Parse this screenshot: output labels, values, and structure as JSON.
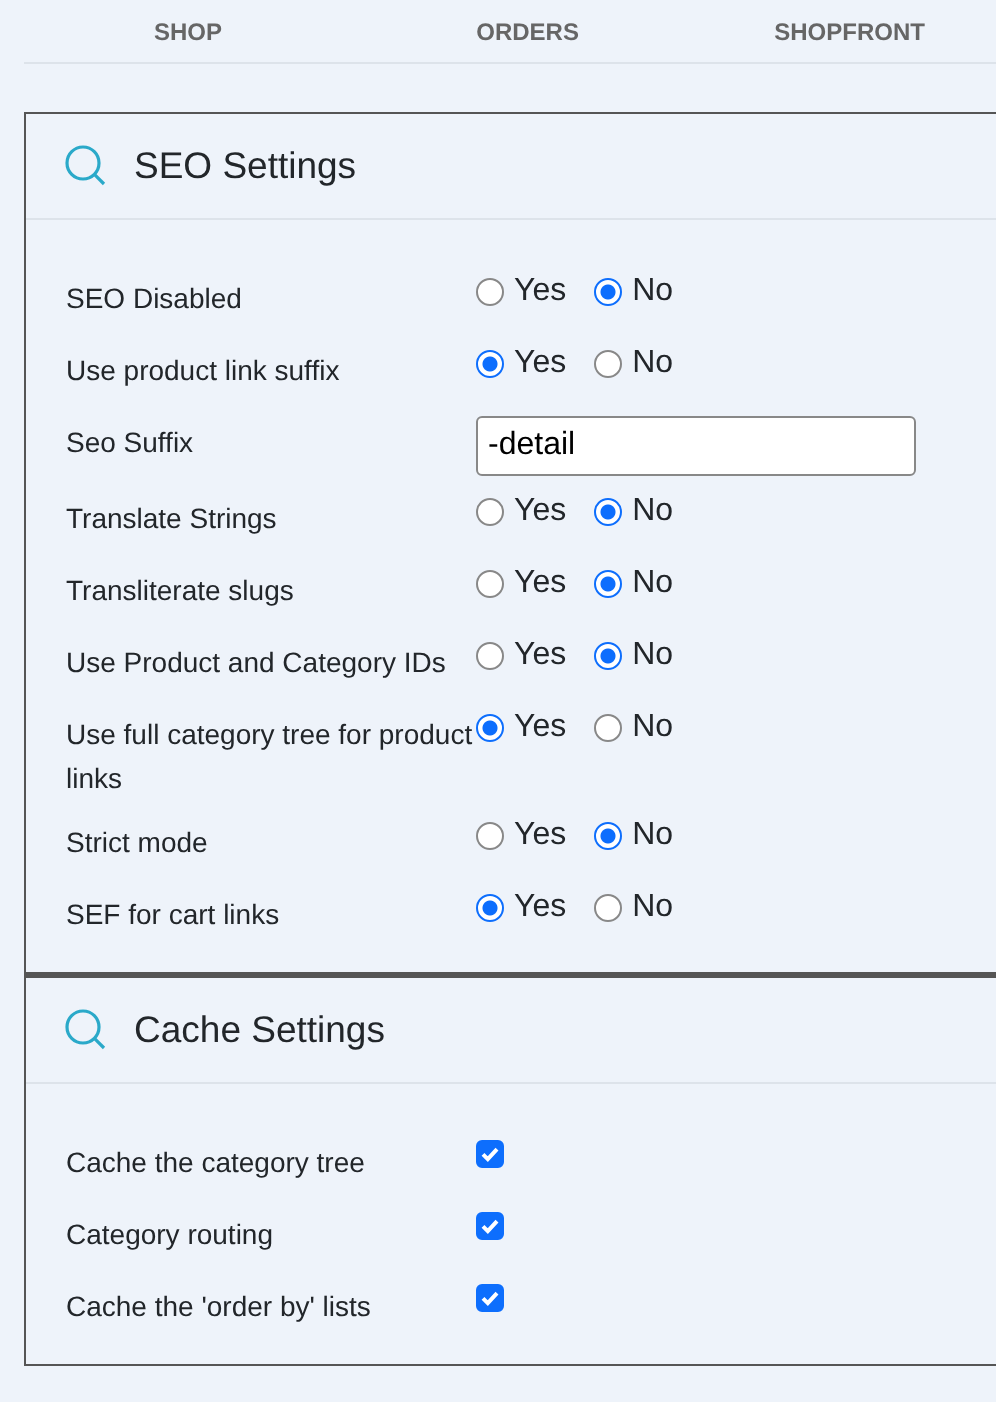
{
  "tabs": [
    {
      "label": "SHOP"
    },
    {
      "label": "ORDERS"
    },
    {
      "label": "SHOPFRONT"
    }
  ],
  "panels": [
    {
      "title": "SEO Settings",
      "rows": [
        {
          "kind": "radio",
          "label": "SEO Disabled",
          "options": [
            {
              "label": "Yes",
              "selected": false
            },
            {
              "label": "No",
              "selected": true
            }
          ]
        },
        {
          "kind": "radio",
          "label": "Use product link suffix",
          "options": [
            {
              "label": "Yes",
              "selected": true
            },
            {
              "label": "No",
              "selected": false
            }
          ]
        },
        {
          "kind": "text",
          "label": "Seo Suffix",
          "value": "-detail"
        },
        {
          "kind": "radio",
          "label": "Translate Strings",
          "options": [
            {
              "label": "Yes",
              "selected": false
            },
            {
              "label": "No",
              "selected": true
            }
          ]
        },
        {
          "kind": "radio",
          "label": "Transliterate slugs",
          "options": [
            {
              "label": "Yes",
              "selected": false
            },
            {
              "label": "No",
              "selected": true
            }
          ]
        },
        {
          "kind": "radio",
          "label": "Use Product and Category IDs",
          "options": [
            {
              "label": "Yes",
              "selected": false
            },
            {
              "label": "No",
              "selected": true
            }
          ]
        },
        {
          "kind": "radio",
          "label": "Use full category tree for product links",
          "options": [
            {
              "label": "Yes",
              "selected": true
            },
            {
              "label": "No",
              "selected": false
            }
          ]
        },
        {
          "kind": "radio",
          "label": "Strict mode",
          "options": [
            {
              "label": "Yes",
              "selected": false
            },
            {
              "label": "No",
              "selected": true
            }
          ]
        },
        {
          "kind": "radio",
          "label": "SEF for cart links",
          "options": [
            {
              "label": "Yes",
              "selected": true
            },
            {
              "label": "No",
              "selected": false
            }
          ]
        }
      ]
    },
    {
      "title": "Cache Settings",
      "rows": [
        {
          "kind": "checkbox",
          "label": "Cache the category tree",
          "checked": true
        },
        {
          "kind": "checkbox",
          "label": "Category routing",
          "checked": true
        },
        {
          "kind": "checkbox",
          "label": "Cache the 'order by' lists",
          "checked": true
        }
      ]
    }
  ]
}
